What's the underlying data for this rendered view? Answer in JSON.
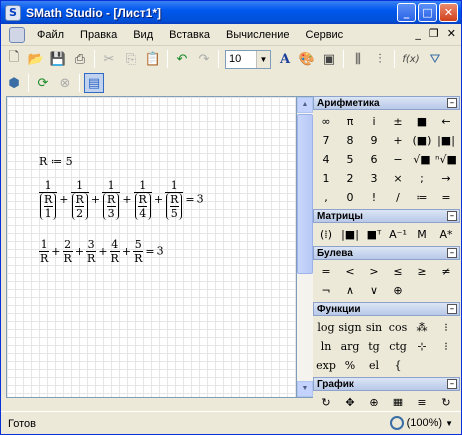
{
  "window": {
    "title": "SMath Studio - [Лист1*]",
    "app_icon": "S",
    "min": "_",
    "max": "□",
    "close": "✕"
  },
  "menu": {
    "items": [
      "Файл",
      "Правка",
      "Вид",
      "Вставка",
      "Вычисление",
      "Сервис"
    ],
    "mdi_min": "_",
    "mdi_restore": "❐",
    "mdi_close": "✕"
  },
  "toolbar": {
    "font_size": "10",
    "bold_glyph": "A",
    "fx_label": "f(x)"
  },
  "worksheet": {
    "assign_var": "R",
    "assign_op": "≔",
    "assign_val": "5",
    "eq1_terms": [
      {
        "num": "1",
        "r": "R",
        "d": "1"
      },
      {
        "num": "1",
        "r": "R",
        "d": "2"
      },
      {
        "num": "1",
        "r": "R",
        "d": "3"
      },
      {
        "num": "1",
        "r": "R",
        "d": "4"
      },
      {
        "num": "1",
        "r": "R",
        "d": "5"
      }
    ],
    "eq1_result": "3",
    "eq2_terms": [
      {
        "num": "1",
        "den": "R"
      },
      {
        "num": "2",
        "den": "R"
      },
      {
        "num": "3",
        "den": "R"
      },
      {
        "num": "4",
        "den": "R"
      },
      {
        "num": "5",
        "den": "R"
      }
    ],
    "eq2_result": "3",
    "plus": "+",
    "equals": "="
  },
  "panels": {
    "arithmetic": {
      "title": "Арифметика",
      "buttons": [
        "∞",
        "π",
        "i",
        "±",
        "■",
        "←",
        "7",
        "8",
        "9",
        "+",
        "(■)",
        "|■|",
        "4",
        "5",
        "6",
        "−",
        "√■",
        "ⁿ√■",
        "1",
        "2",
        "3",
        "×",
        ";",
        "→",
        ",",
        "0",
        "!",
        "/",
        "≔",
        "="
      ]
    },
    "matrices": {
      "title": "Матрицы",
      "buttons": [
        "(⁞)",
        "|■|",
        "■ᵀ",
        "A⁻¹",
        "M",
        "A*"
      ]
    },
    "boolean": {
      "title": "Булева",
      "buttons": [
        "=",
        "<",
        ">",
        "≤",
        "≥",
        "≠",
        "¬",
        "∧",
        "∨",
        "⊕"
      ]
    },
    "functions": {
      "title": "Функции",
      "buttons": [
        "log",
        "sign",
        "sin",
        "cos",
        "⁂",
        "⁝",
        "ln",
        "arg",
        "tg",
        "ctg",
        "⊹",
        "⁝",
        "exp",
        "%",
        "el",
        "{"
      ]
    },
    "graph": {
      "title": "График",
      "buttons": [
        "↻",
        "✥",
        "⊕",
        "▦",
        "≡",
        "↻"
      ]
    }
  },
  "status": {
    "text": "Готов",
    "zoom": "(100%)"
  }
}
